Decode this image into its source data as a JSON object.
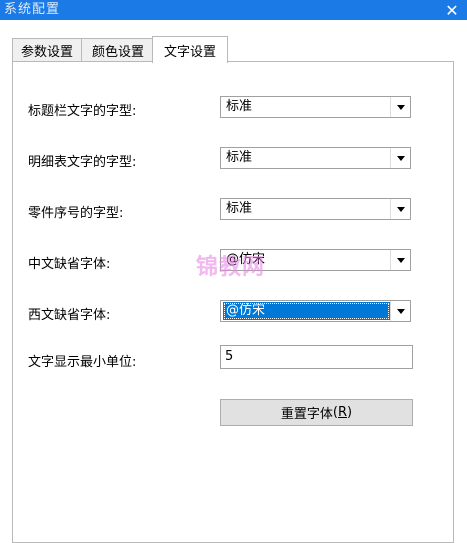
{
  "window": {
    "title": "系统配置",
    "close_glyph": "✕"
  },
  "tabs": [
    {
      "label": "参数设置",
      "active": false
    },
    {
      "label": "颜色设置",
      "active": false
    },
    {
      "label": "文字设置",
      "active": true
    }
  ],
  "settings": {
    "titlebar_font": {
      "label": "标题栏文字的字型:",
      "value": "标准"
    },
    "detail_table_font": {
      "label": "明细表文字的字型:",
      "value": "标准"
    },
    "part_number_font": {
      "label": "零件序号的字型:",
      "value": "标准"
    },
    "chinese_default_font": {
      "label": "中文缺省字体:",
      "value": "@仿宋"
    },
    "western_default_font": {
      "label": "西文缺省字体:",
      "value": "@仿宋"
    },
    "min_text_unit": {
      "label": "文字显示最小单位:",
      "value": "5"
    }
  },
  "reset_button": {
    "label": "重置字体",
    "mnemonic": "R"
  },
  "watermark": "锦教网",
  "colors": {
    "titlebar": "#1c7ae6",
    "selection": "#0078d7"
  }
}
